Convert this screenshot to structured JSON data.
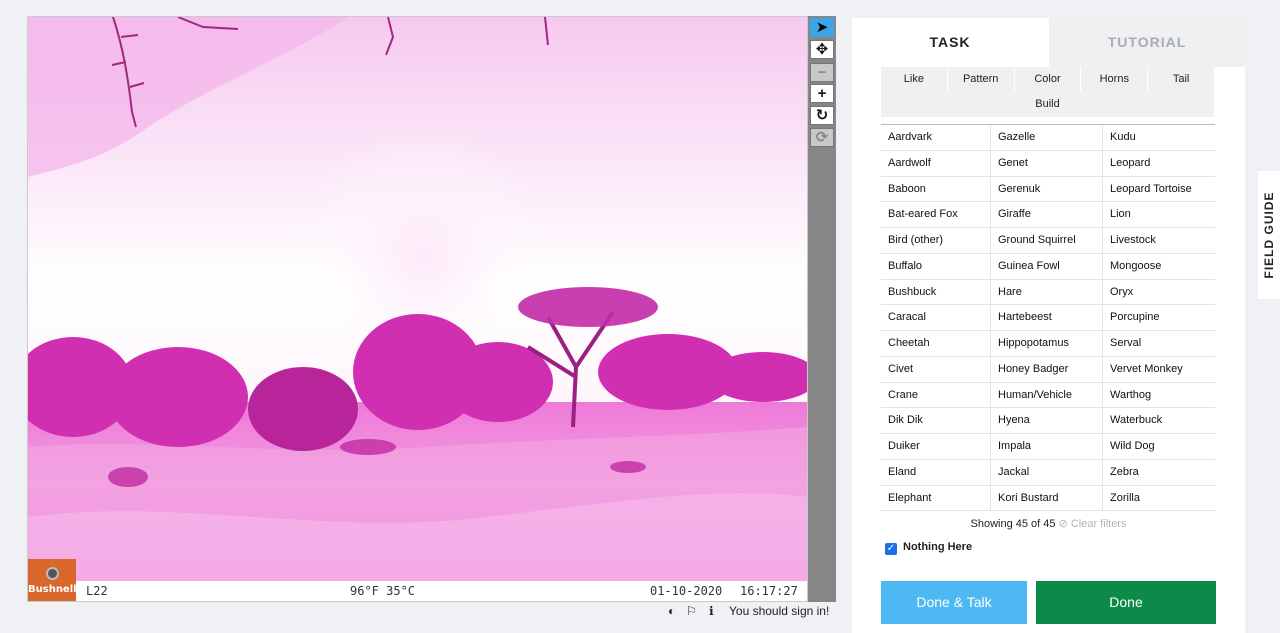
{
  "viewer": {
    "camera_brand": "Bushnell",
    "cam_id": "L22",
    "temperature": "96°F 35°C",
    "date": "01-10-2020",
    "time": "16:17:27"
  },
  "toolbar": {
    "annotate_icon": "pointer-arrow-icon",
    "move_icon": "move-arrows-icon",
    "zoom_out_icon": "minus-icon",
    "zoom_in_icon": "plus-icon",
    "rotate_icon": "rotate-icon",
    "reset_icon": "reset-icon",
    "annotate_glyph": "➤",
    "move_glyph": "✥",
    "zoom_out_glyph": "−",
    "zoom_in_glyph": "+",
    "rotate_glyph": "↻",
    "reset_glyph": "⟳"
  },
  "meta": {
    "invert_glyph": "◐",
    "flag_glyph": "⚐",
    "info_glyph": "ℹ",
    "sign_in_text": "You should sign in!"
  },
  "tabs": {
    "task": "TASK",
    "tutorial": "TUTORIAL"
  },
  "filters": {
    "row1": [
      "Like",
      "Pattern",
      "Color",
      "Horns",
      "Tail"
    ],
    "row2": [
      "Build"
    ]
  },
  "species": [
    [
      "Aardvark",
      "Gazelle",
      "Kudu"
    ],
    [
      "Aardwolf",
      "Genet",
      "Leopard"
    ],
    [
      "Baboon",
      "Gerenuk",
      "Leopard Tortoise"
    ],
    [
      "Bat-eared Fox",
      "Giraffe",
      "Lion"
    ],
    [
      "Bird (other)",
      "Ground Squirrel",
      "Livestock"
    ],
    [
      "Buffalo",
      "Guinea Fowl",
      "Mongoose"
    ],
    [
      "Bushbuck",
      "Hare",
      "Oryx"
    ],
    [
      "Caracal",
      "Hartebeest",
      "Porcupine"
    ],
    [
      "Cheetah",
      "Hippopotamus",
      "Serval"
    ],
    [
      "Civet",
      "Honey Badger",
      "Vervet Monkey"
    ],
    [
      "Crane",
      "Human/Vehicle",
      "Warthog"
    ],
    [
      "Dik Dik",
      "Hyena",
      "Waterbuck"
    ],
    [
      "Duiker",
      "Impala",
      "Wild Dog"
    ],
    [
      "Eland",
      "Jackal",
      "Zebra"
    ],
    [
      "Elephant",
      "Kori Bustard",
      "Zorilla"
    ]
  ],
  "showing": {
    "text": "Showing 45 of 45",
    "clear": "⊘ Clear filters"
  },
  "nothing_here": {
    "label": "Nothing Here",
    "checked": true,
    "check_glyph": "✓"
  },
  "buttons": {
    "done_talk": "Done & Talk",
    "done": "Done"
  },
  "field_guide": "FIELD GUIDE",
  "colors": {
    "accent_blue": "#4db8f2",
    "done_green": "#0b8a4a",
    "checkbox_blue": "#1f6fe5",
    "image_tint": "#e23fc4"
  }
}
